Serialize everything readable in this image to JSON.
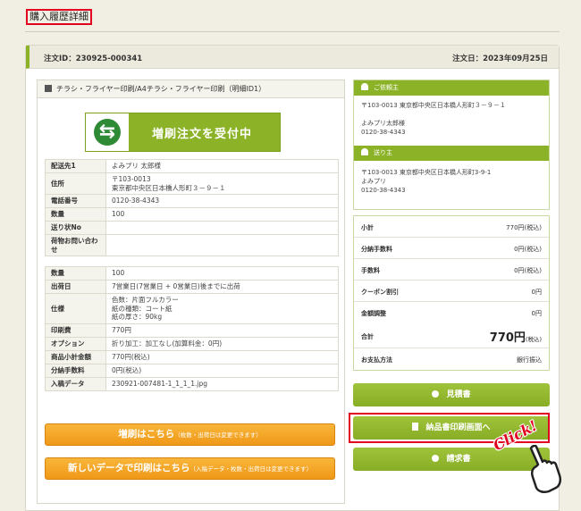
{
  "page_title": "購入履歴詳細",
  "order": {
    "id_text": "注文ID：230925-000341",
    "date_text": "注文日：2023年09月25日"
  },
  "product_header": "チラシ・フライヤー印刷/A4チラシ・フライヤー印刷（明細ID1）",
  "reorder_banner": "増刷注文を受付中",
  "table1": [
    {
      "k": "配送先1",
      "v": "よみプリ 太郎様"
    },
    {
      "k": "住所",
      "v": "〒103-0013\n東京都中央区日本橋人形町３－９－１"
    },
    {
      "k": "電話番号",
      "v": "0120-38-4343"
    },
    {
      "k": "数量",
      "v": "100"
    },
    {
      "k": "送り状No",
      "v": ""
    },
    {
      "k": "荷物お問い合わせ",
      "v": ""
    }
  ],
  "table2": [
    {
      "k": "数量",
      "v": "100"
    },
    {
      "k": "出荷日",
      "v": "7営業日(7営業日 + 0営業日)後までに出荷"
    },
    {
      "k": "仕様",
      "v": "色数：片面フルカラー\n紙の種類：コート紙\n紙の厚さ：90kg"
    },
    {
      "k": "印刷費",
      "v": "770円"
    },
    {
      "k": "オプション",
      "v": "折り加工：加工なし(加算料金：0円)"
    },
    {
      "k": "商品小計金額",
      "v": "770円(税込)"
    },
    {
      "k": "分納手数料",
      "v": "0円(税込)"
    },
    {
      "k": "入稿データ",
      "v": "230921-007481-1_1_1_1.jpg"
    }
  ],
  "buttons": {
    "reprint": "増刷はこちら",
    "reprint_note": "（枚数・出荷日は変更できます）",
    "new_print": "新しいデータで印刷はこちら",
    "new_print_note": "（入稿データ・枚数・出荷日は変更できます）",
    "estimate": "見積書",
    "delivery_note": "納品書印刷画面へ",
    "invoice": "請求書"
  },
  "orderer": {
    "title": "ご依頼主",
    "address": "〒103-0013 東京都中央区日本橋人形町３－９－１",
    "name": "よみプリ太郎様",
    "tel": "0120-38-4343"
  },
  "sender": {
    "title": "送り主",
    "address": "〒103-0013 東京都中央区日本橋人形町3-9-1",
    "name": "よみプリ",
    "tel": "0120-38-4343"
  },
  "summary": [
    {
      "k": "小計",
      "v": "770円(税込)"
    },
    {
      "k": "分納手数料",
      "v": "0円(税込)"
    },
    {
      "k": "手数料",
      "v": "0円(税込)"
    },
    {
      "k": "クーポン割引",
      "v": "0円"
    },
    {
      "k": "金額調整",
      "v": "0円"
    }
  ],
  "total": {
    "k": "合計",
    "v_big": "770円",
    "v_small": "(税込)"
  },
  "payment": {
    "k": "お支払方法",
    "v": "銀行振込"
  },
  "annotation": "Click!",
  "colors": {
    "accent_green": "#8cb328",
    "orange": "#f09818",
    "highlight_red": "#e1001f"
  }
}
